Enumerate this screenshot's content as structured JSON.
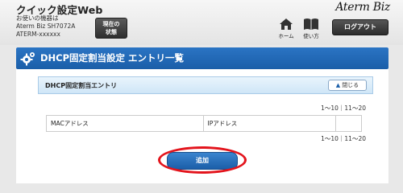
{
  "header": {
    "app_title": "クイック設定Web",
    "device_line1": "お使いの機器は",
    "device_line2": "Aterm Biz SH7072A",
    "device_line3": "ATERM-xxxxxx",
    "status_line1": "現在の",
    "status_line2": "状態",
    "logo": "Aterm Biz",
    "home_label": "ホーム",
    "help_label": "使い方",
    "logout_label": "ログアウト"
  },
  "panel": {
    "title": "DHCP固定割当設定 エントリ一覧",
    "section_title": "DHCP固定割当エントリ",
    "close_label": "閉じる",
    "pager_top": "1～10｜11～20",
    "pager_bottom": "1～10｜11～20",
    "table": {
      "columns": [
        "MACアドレス",
        "IPアドレス",
        ""
      ]
    },
    "add_label": "追加"
  },
  "colors": {
    "title_bar": "#1a5ea8",
    "highlight": "#e3141c",
    "section_bg": "#d9ecf9"
  }
}
